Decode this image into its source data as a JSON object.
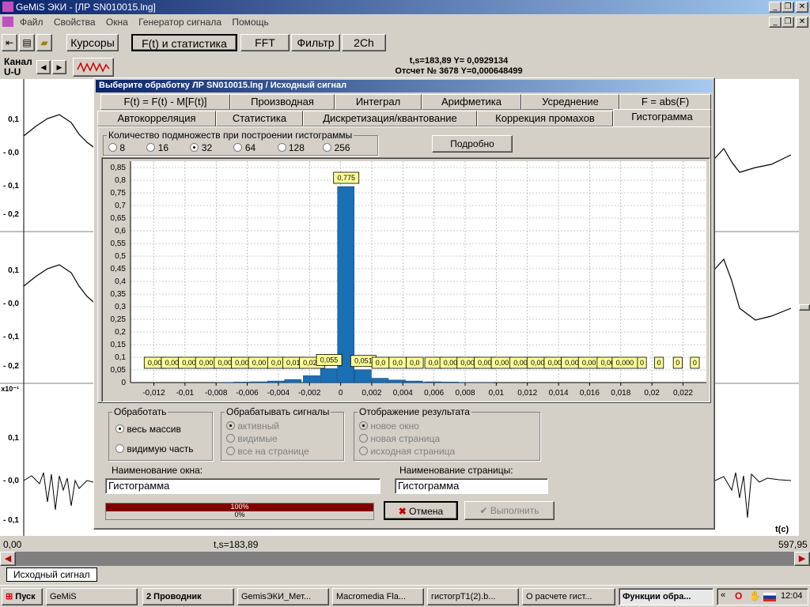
{
  "app": {
    "title": "GeMiS ЭКИ - [ЛР SN010015.lng]"
  },
  "menu": [
    "Файл",
    "Свойства",
    "Окна",
    "Генератор сигнала",
    "Помощь"
  ],
  "toolbar": {
    "buttons": [
      "Курсоры",
      "F(t) и статистика",
      "FFT",
      "Фильтр",
      "2Ch"
    ]
  },
  "channel": {
    "label": "Канал",
    "value": "U-U"
  },
  "cursor": {
    "line1": "t,s=183,89  Y= 0,0929134",
    "line2": "Отсчет № 3678 Y=0,000648499"
  },
  "bg_ylabels": {
    "panel1": [
      "0,1",
      "- 0,0",
      "- 0,1",
      "- 0,2"
    ],
    "panel2": [
      "0,1",
      "- 0,0",
      "- 0,1",
      "- 0,2"
    ],
    "panel3": [
      "x10⁻¹",
      "0,1",
      "- 0,0",
      "- 0,1"
    ]
  },
  "bottom": {
    "left": "0,00",
    "mid": "t,s=183,89",
    "right": "597,95",
    "axis": "t(c)"
  },
  "page_tab": "Исходный сигнал",
  "dialog": {
    "title": "Выберите обработку  ЛР SN010015.lng / Исходный сигнал",
    "tabs_row1": [
      "F(t) = F(t) - M[F(t)]",
      "Производная",
      "Интеграл",
      "Арифметика",
      "Усреднение",
      "F = abs(F)"
    ],
    "tabs_row2": [
      "Автокорреляция",
      "Статистика",
      "Дискретизация/квантование",
      "Коррекция промахов",
      "Гистограмма"
    ],
    "subsets": {
      "label": "Количество подмножеств при построении гистограммы",
      "options": [
        "8",
        "16",
        "32",
        "64",
        "128",
        "256"
      ],
      "selected": "32"
    },
    "details_button": "Подробно",
    "process": {
      "label": "Обработать",
      "options": [
        "весь массив",
        "видимую часть"
      ],
      "selected": "весь массив"
    },
    "signals": {
      "label": "Обрабатывать сигналы",
      "options": [
        "активный",
        "видимые",
        "все на странице"
      ]
    },
    "output": {
      "label": "Отображение результата",
      "options": [
        "новое окно",
        "новая страница",
        "исходная страница"
      ]
    },
    "window_name_label": "Наименование окна:",
    "window_name": "Гистограмма",
    "page_name_label": "Наименование страницы:",
    "page_name": "Гистограмма",
    "progress": {
      "top": "100%",
      "bottom": "0%",
      "top_fraction": 1,
      "bottom_fraction": 0
    },
    "cancel": "Отмена",
    "execute": "Выполнить"
  },
  "chart_data": {
    "type": "bar",
    "title": "",
    "xlabel": "",
    "ylabel": "",
    "xlim": [
      -0.0135,
      0.0235
    ],
    "ylim": [
      0,
      0.875
    ],
    "yticks": [
      "0",
      "0,05",
      "0,1",
      "0,15",
      "0,2",
      "0,25",
      "0,3",
      "0,35",
      "0,4",
      "0,45",
      "0,5",
      "0,55",
      "0,6",
      "0,65",
      "0,7",
      "0,75",
      "0,8",
      "0,85"
    ],
    "xticks": [
      {
        "v": -0.012,
        "t": "-0,012"
      },
      {
        "v": -0.01,
        "t": "-0,01"
      },
      {
        "v": -0.008,
        "t": "-0,008"
      },
      {
        "v": -0.006,
        "t": "-0,006"
      },
      {
        "v": -0.004,
        "t": "-0,004"
      },
      {
        "v": -0.002,
        "t": "-0,002"
      },
      {
        "v": 0,
        "t": "0"
      },
      {
        "v": 0.002,
        "t": "0,002"
      },
      {
        "v": 0.004,
        "t": "0,004"
      },
      {
        "v": 0.006,
        "t": "0,006"
      },
      {
        "v": 0.008,
        "t": "0,008"
      },
      {
        "v": 0.01,
        "t": "0,01"
      },
      {
        "v": 0.012,
        "t": "0,012"
      },
      {
        "v": 0.014,
        "t": "0,014"
      },
      {
        "v": 0.016,
        "t": "0,016"
      },
      {
        "v": 0.018,
        "t": "0,018"
      },
      {
        "v": 0.02,
        "t": "0,02"
      },
      {
        "v": 0.022,
        "t": "0,022"
      }
    ],
    "bin_width": 0.00112,
    "bins": [
      {
        "x": -0.0125,
        "v": 0.0,
        "label": "0,00"
      },
      {
        "x": -0.0114,
        "v": 0.0,
        "label": "0,00"
      },
      {
        "x": -0.0103,
        "v": 0.0,
        "label": "0,00"
      },
      {
        "x": -0.0092,
        "v": 0.0,
        "label": "0,00"
      },
      {
        "x": -0.008,
        "v": 0.001,
        "label": "0,00"
      },
      {
        "x": -0.0069,
        "v": 0.002,
        "label": "0,00"
      },
      {
        "x": -0.0058,
        "v": 0.003,
        "label": "0,00"
      },
      {
        "x": -0.0047,
        "v": 0.006,
        "label": "0,0"
      },
      {
        "x": -0.0036,
        "v": 0.012,
        "label": "0,01"
      },
      {
        "x": -0.0024,
        "v": 0.027,
        "label": "0,027"
      },
      {
        "x": -0.0013,
        "v": 0.055,
        "label": "0,055"
      },
      {
        "x": -0.0002,
        "v": 0.775,
        "label": "0,775"
      },
      {
        "x": 0.0009,
        "v": 0.051,
        "label": "0,051"
      },
      {
        "x": 0.002,
        "v": 0.017,
        "label": "0,0"
      },
      {
        "x": 0.0031,
        "v": 0.01,
        "label": "0,0"
      },
      {
        "x": 0.0042,
        "v": 0.006,
        "label": "0,0"
      },
      {
        "x": 0.0054,
        "v": 0.003,
        "label": "0,0"
      },
      {
        "x": 0.0065,
        "v": 0.002,
        "label": "0,00"
      },
      {
        "x": 0.0076,
        "v": 0.001,
        "label": "0,00"
      },
      {
        "x": 0.0087,
        "v": 0.001,
        "label": "0,00"
      },
      {
        "x": 0.0098,
        "v": 0.0,
        "label": "0,00"
      },
      {
        "x": 0.011,
        "v": 0.0,
        "label": "0,00"
      },
      {
        "x": 0.0121,
        "v": 0.0,
        "label": "0,00"
      },
      {
        "x": 0.0132,
        "v": 0.0,
        "label": "0,00"
      },
      {
        "x": 0.0143,
        "v": 0.0,
        "label": "0,00"
      },
      {
        "x": 0.0154,
        "v": 0.0,
        "label": "0,00"
      },
      {
        "x": 0.0166,
        "v": 0.0,
        "label": "0,00"
      },
      {
        "x": 0.0177,
        "v": 0.0,
        "label": "0,000"
      },
      {
        "x": 0.0188,
        "v": 0.0,
        "label": "0"
      },
      {
        "x": 0.0199,
        "v": 0.0,
        "label": "0"
      },
      {
        "x": 0.0211,
        "v": 0.0,
        "label": "0"
      },
      {
        "x": 0.0222,
        "v": 0.0,
        "label": "0"
      }
    ],
    "bar_color": "#1a6fb5",
    "grid": true
  },
  "taskbar": {
    "start": "Пуск",
    "items": [
      "GeMiS",
      "2 Проводник",
      "GemisЭКИ_Мет...",
      "Macromedia Fla...",
      "гистогрТ1(2).b...",
      "О расчете гист...",
      "Функции обра..."
    ],
    "clock": "12:04"
  }
}
